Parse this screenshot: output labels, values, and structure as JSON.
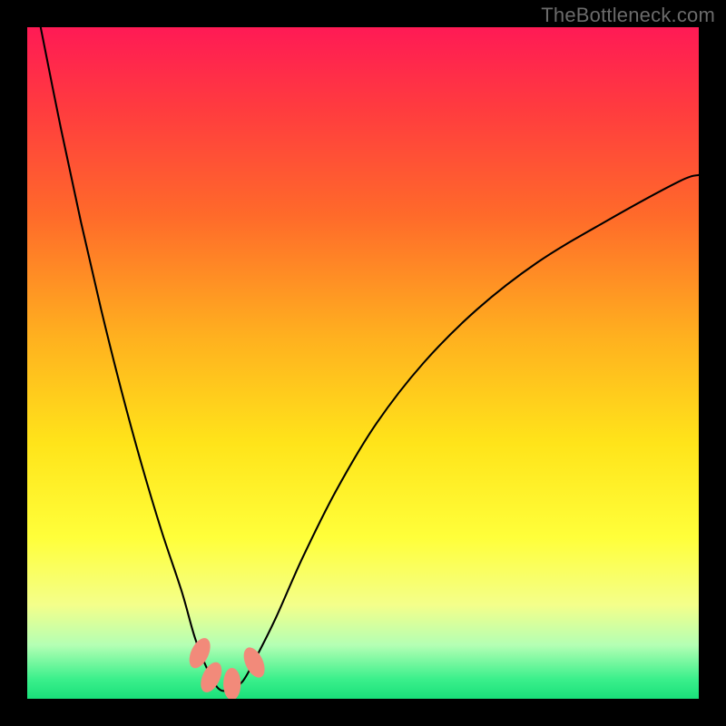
{
  "attribution": "TheBottleneck.com",
  "chart_data": {
    "type": "line",
    "title": "",
    "xlabel": "",
    "ylabel": "",
    "xlim": [
      0,
      100
    ],
    "ylim": [
      0,
      100
    ],
    "background_gradient_stops": [
      {
        "pct": 0,
        "color": "#ff1a55"
      },
      {
        "pct": 12,
        "color": "#ff3b3f"
      },
      {
        "pct": 28,
        "color": "#ff6a2a"
      },
      {
        "pct": 46,
        "color": "#ffb01f"
      },
      {
        "pct": 62,
        "color": "#ffe41a"
      },
      {
        "pct": 76,
        "color": "#ffff3a"
      },
      {
        "pct": 86,
        "color": "#f4ff8a"
      },
      {
        "pct": 92,
        "color": "#b4ffb4"
      },
      {
        "pct": 97,
        "color": "#3cf08c"
      },
      {
        "pct": 100,
        "color": "#19e07a"
      }
    ],
    "series": [
      {
        "name": "bottleneck-curve",
        "x": [
          2,
          5,
          8,
          11,
          14,
          17,
          20,
          23,
          25,
          27,
          28.5,
          30,
          32,
          34,
          37,
          41,
          46,
          52,
          59,
          67,
          76,
          86,
          97,
          100
        ],
        "y": [
          100,
          85,
          71,
          58,
          46,
          35,
          25,
          16,
          9,
          4,
          1.5,
          1.3,
          2.5,
          6,
          12,
          21,
          31,
          41,
          50,
          58,
          65,
          71,
          77,
          78
        ]
      }
    ],
    "markers": {
      "name": "highlight-points",
      "color": "#f28a7a",
      "points": [
        {
          "x": 25.7,
          "y": 6.8
        },
        {
          "x": 27.4,
          "y": 3.2
        },
        {
          "x": 30.5,
          "y": 2.2
        },
        {
          "x": 33.8,
          "y": 5.4
        }
      ],
      "marker_rx": 1.3,
      "marker_ry": 2.4
    }
  }
}
